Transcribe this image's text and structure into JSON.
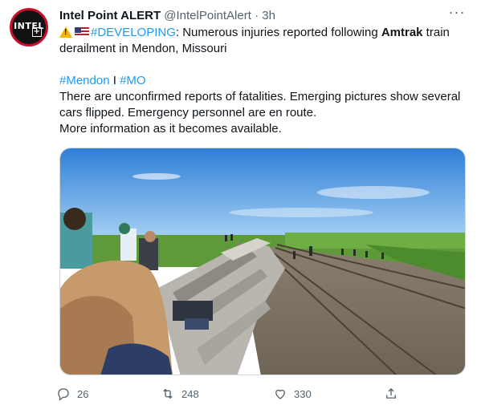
{
  "tweet": {
    "display_name": "Intel Point ALERT",
    "handle": "@IntelPointAlert",
    "separator": "·",
    "time": "3h",
    "more_label": "···",
    "avatar_text": "INTEL",
    "avatar_plus": "+",
    "warning_symbol": "!",
    "hashtag_developing": "#DEVELOPING",
    "line1_text": ": Numerous injuries reported following ",
    "line1_bold": "Amtrak",
    "line1_rest": " train derailment in Mendon, Missouri",
    "hashtag_mendon": "#Mendon",
    "hashtag_sep": " I ",
    "hashtag_mo": "#MO",
    "paragraph2": "There are unconfirmed reports of fatalities. Emerging pictures show several cars flipped. Emergency personnel are en route.",
    "paragraph3": "More information as it becomes available."
  },
  "actions": {
    "replies": "26",
    "retweets": "248",
    "likes": "330"
  },
  "colors": {
    "link": "#1d9bf0",
    "secondary_text": "#536471",
    "avatar_ring": "#c8102e"
  }
}
